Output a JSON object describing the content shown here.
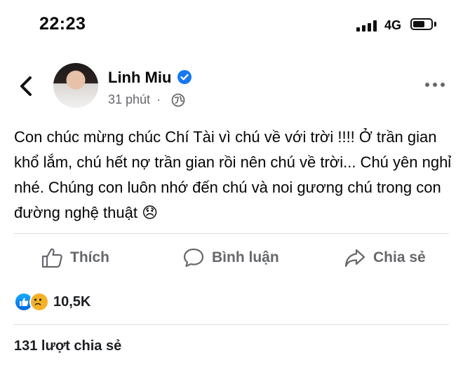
{
  "status_bar": {
    "time": "22:23",
    "network": "4G",
    "signal_bars": 4,
    "battery_level": 0.6
  },
  "header": {
    "name": "Linh Miu",
    "time_ago": "31 phút",
    "separator": "·",
    "verified": true,
    "privacy_icon": "globe-icon"
  },
  "post": {
    "text": "Con chúc mừng chúc Chí Tài vì chú về với trời !!!! Ở trần gian khổ lắm, chú hết nợ trần gian rồi nên chú về trời... Chú yên nghỉ nhé. Chúng con luôn nhớ đến chú và noi gương chú trong con đường nghệ thuật 😞"
  },
  "actions": {
    "like": "Thích",
    "comment": "Bình luận",
    "share": "Chia sẻ"
  },
  "reactions": {
    "types": [
      "like",
      "sad"
    ],
    "count": "10,5K"
  },
  "shares": {
    "label": "131 lượt chia sẻ"
  },
  "colors": {
    "accent": "#1877f2",
    "muted": "#65676b",
    "text": "#050505",
    "divider": "#dadde1"
  }
}
